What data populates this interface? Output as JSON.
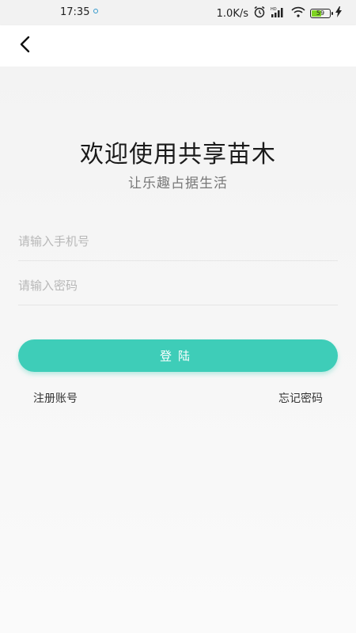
{
  "status_bar": {
    "time": "17:35",
    "network_speed": "1.0K/s",
    "battery_level": "59",
    "battery_fraction": 0.59,
    "icons": [
      "alarm-icon",
      "hd-signal-icon",
      "wifi-icon",
      "battery-icon",
      "charging-icon"
    ]
  },
  "nav": {
    "back_icon": "chevron-left-icon"
  },
  "welcome": {
    "title": "欢迎使用共享苗木",
    "subtitle": "让乐趣占据生活"
  },
  "form": {
    "phone_placeholder": "请输入手机号",
    "password_placeholder": "请输入密码",
    "phone_value": "",
    "password_value": "",
    "login_label": "登陆",
    "register_label": "注册账号",
    "forgot_label": "忘记密码"
  },
  "colors": {
    "accent": "#3ecdb8",
    "background": "#f7f7f7"
  }
}
